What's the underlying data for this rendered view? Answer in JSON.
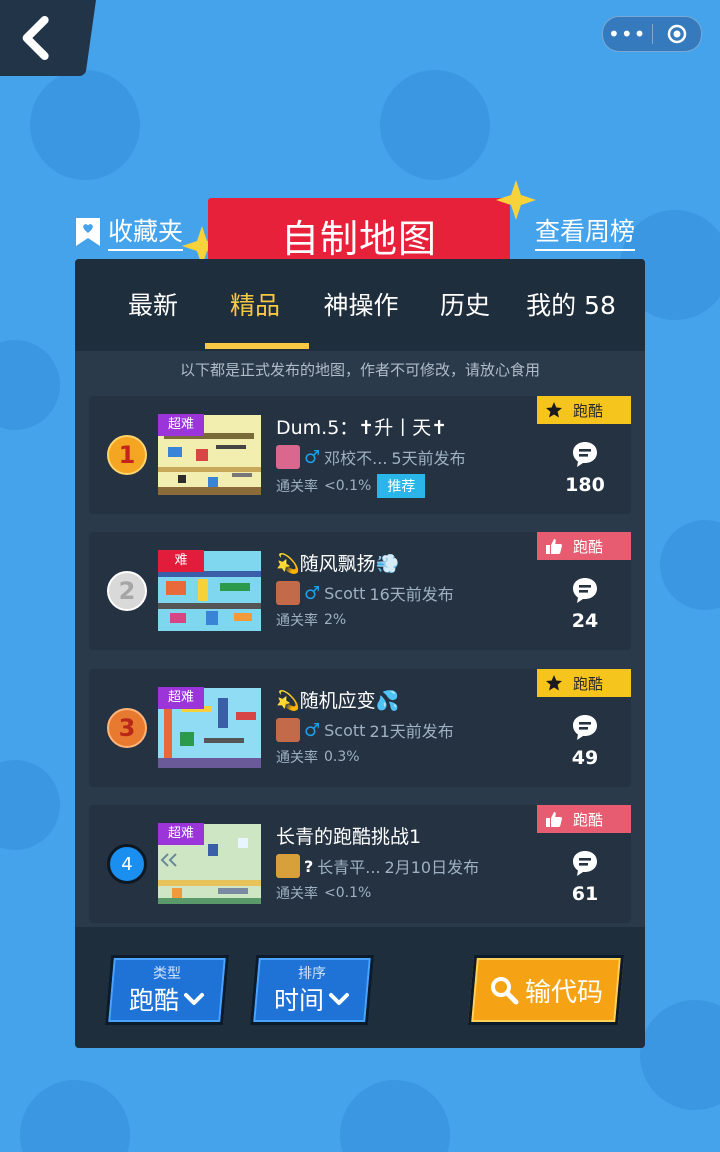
{
  "header": {
    "favorites_label": "收藏夹",
    "title": "自制地图",
    "weekly_label": "查看周榜"
  },
  "tabs": [
    {
      "label": "最新"
    },
    {
      "label": "精品"
    },
    {
      "label": "神操作"
    },
    {
      "label": "历史"
    },
    {
      "label": "我的 58"
    }
  ],
  "active_tab": "精品",
  "notice": "以下都是正式发布的地图，作者不可修改，请放心食用",
  "maps": [
    {
      "rank": "1",
      "difficulty": "超难",
      "difficulty_color": "#9b35d9",
      "title": "Dum.5：✝升丨天✝",
      "gender_icon": "♂",
      "author": "邓校不...",
      "published": "5天前发布",
      "pass_rate_label": "通关率",
      "pass_rate": "<0.1%",
      "recommend": "推荐",
      "type_tag": "跑酷",
      "type_tag_icon": "star-icon",
      "comments": "180",
      "thumb_color": "#f2eeb0"
    },
    {
      "rank": "2",
      "difficulty": "难",
      "difficulty_color": "#e21d3c",
      "title": "💫随风飘扬💨",
      "gender_icon": "♂",
      "author": "Scott",
      "published": "16天前发布",
      "pass_rate_label": "通关率",
      "pass_rate": "2%",
      "type_tag": "跑酷",
      "type_tag_icon": "thumbs-up-icon",
      "comments": "24",
      "thumb_color": "#7fd6ef"
    },
    {
      "rank": "3",
      "difficulty": "超难",
      "difficulty_color": "#9b35d9",
      "title": "💫随机应变💦",
      "gender_icon": "♂",
      "author": "Scott",
      "published": "21天前发布",
      "pass_rate_label": "通关率",
      "pass_rate": "0.3%",
      "type_tag": "跑酷",
      "type_tag_icon": "star-icon",
      "comments": "49",
      "thumb_color": "#8fdcf4"
    },
    {
      "rank": "4",
      "difficulty": "超难",
      "difficulty_color": "#9b35d9",
      "title": "长青的跑酷挑战1",
      "gender_icon": "?",
      "author": "长青平...",
      "published": "2月10日发布",
      "pass_rate_label": "通关率",
      "pass_rate": "<0.1%",
      "type_tag": "跑酷",
      "type_tag_icon": "thumbs-up-icon",
      "comments": "61",
      "thumb_color": "#cfe6c4"
    }
  ],
  "bottom": {
    "type_caption": "类型",
    "type_value": "跑酷",
    "sort_caption": "排序",
    "sort_value": "时间",
    "code_label": "输代码"
  },
  "colors": {
    "background": "#45a3ec",
    "panel": "#2a3a4a",
    "accent_yellow": "#f7c843",
    "banner_red": "#e8213b"
  }
}
